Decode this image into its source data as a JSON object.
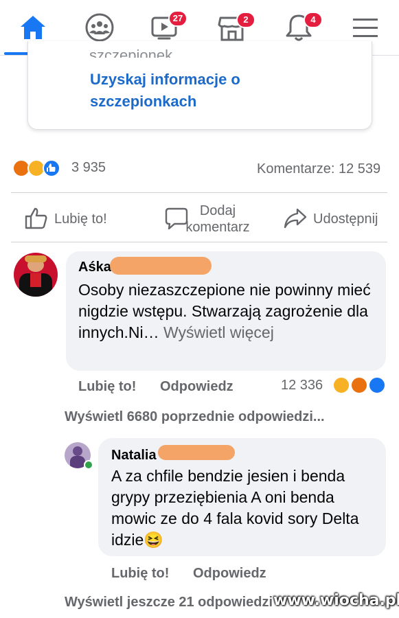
{
  "nav": {
    "badges": {
      "watch": "27",
      "marketplace": "2",
      "notifications": "4"
    },
    "accent": "#1877f2",
    "icons": [
      "home-icon",
      "groups-icon",
      "watch-icon",
      "marketplace-icon",
      "bell-icon",
      "menu-icon"
    ]
  },
  "card": {
    "cut_text": "szczepionek.",
    "link_text": "Uzyskaj informacje o szczepionkach"
  },
  "post": {
    "reactions_count": "3 935",
    "comments_count": "Komentarze: 12 539"
  },
  "actions": {
    "like": "Lubię to!",
    "comment": "Dodaj komentarz",
    "share": "Udostępnij"
  },
  "comments": [
    {
      "author": "Aśka",
      "text": "Osoby  niezaszczepione nie powinny mieć nigdzie wstępu. Stwarzają zagrożenie dla innych.Ni…",
      "see_more": "Wyświetl więcej",
      "like": "Lubię to!",
      "reply": "Odpowiedz",
      "reactions": "12 336",
      "prev_replies": "Wyświetl 6680 poprzednie odpowiedzi..."
    },
    {
      "author": "Natalia",
      "text": "A za chfile bendzie jesien i benda grypy przeziębienia A oni benda mowic ze do 4 fala kovid sory Delta idzie",
      "emoji": "😆",
      "like": "Lubię to!",
      "reply": "Odpowiedz",
      "more_replies": "Wyświetl jeszcze 21 odpowiedzi"
    }
  ],
  "watermark": "www.wiocha.pl"
}
